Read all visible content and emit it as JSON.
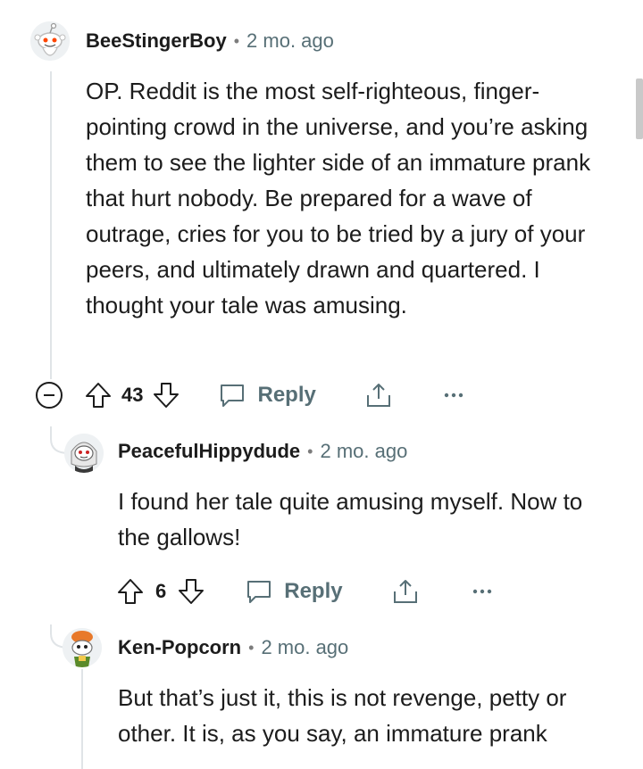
{
  "comments": [
    {
      "username": "BeeStingerBoy",
      "time": "2 mo. ago",
      "text": "OP. Reddit is the most self-righteous, finger-pointing crowd in the universe, and you’re asking them to see the lighter side of an immature prank that hurt nobody. Be prepared for a wave of outrage, cries for you to be tried by a jury of your peers, and ultimately drawn and quartered. I thought your tale was amusing.",
      "votes": "43",
      "reply_label": "Reply"
    },
    {
      "username": "PeacefulHippydude",
      "time": "2 mo. ago",
      "text": "I found her tale quite amusing myself. Now to the gallows!",
      "votes": "6",
      "reply_label": "Reply"
    },
    {
      "username": "Ken-Popcorn",
      "time": "2 mo. ago",
      "text": "But that’s just it, this is not revenge, petty or other. It is, as you say, an immature prank"
    }
  ],
  "icons": {
    "collapse": "collapse-minus-icon",
    "upvote": "arrow-up-icon",
    "downvote": "arrow-down-icon",
    "reply": "speech-bubble-icon",
    "share": "share-icon",
    "more": "more-dots-icon"
  },
  "colors": {
    "text": "#1c1c1c",
    "meta": "#576f76",
    "thread_line": "#e0e4e7"
  }
}
